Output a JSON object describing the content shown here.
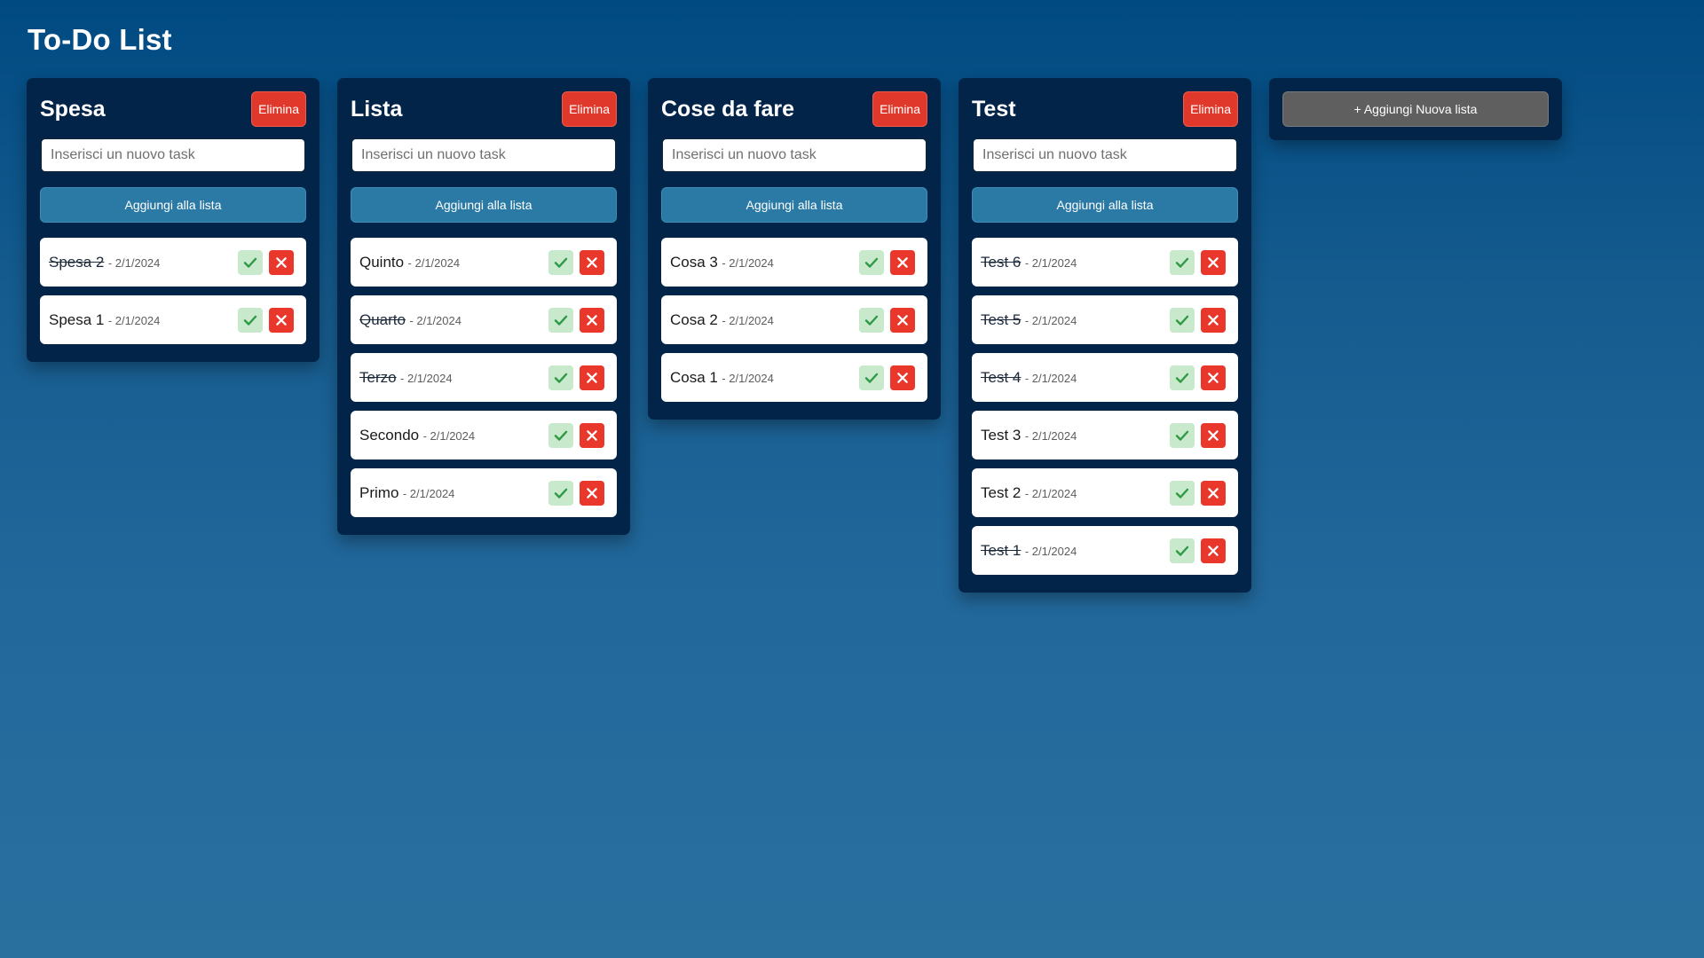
{
  "app": {
    "title": "To-Do List"
  },
  "colors": {
    "background_top": "#004a82",
    "background_bottom": "#2a709f",
    "card": "#022449",
    "delete": "#e0392b",
    "add_task": "#2a7aa5",
    "complete_bg": "#c9e9cc",
    "complete_check": "#2e9a45",
    "remove_bg": "#e9372b",
    "add_list": "#5f5f5f"
  },
  "icons": {
    "complete": "check-icon",
    "remove": "x-close-icon"
  },
  "labels": {
    "delete_list": "Elimina",
    "input_placeholder": "Inserisci un nuovo task",
    "add_task": "Aggiungi alla lista",
    "add_list": "+ Aggiungi Nuova lista"
  },
  "lists": [
    {
      "title": "Spesa",
      "tasks": [
        {
          "name": "Spesa 2",
          "date": "- 2/1/2024",
          "done": true
        },
        {
          "name": "Spesa 1",
          "date": "- 2/1/2024",
          "done": false
        }
      ]
    },
    {
      "title": "Lista",
      "tasks": [
        {
          "name": "Quinto",
          "date": "- 2/1/2024",
          "done": false
        },
        {
          "name": "Quarto",
          "date": "- 2/1/2024",
          "done": true
        },
        {
          "name": "Terzo",
          "date": "- 2/1/2024",
          "done": true
        },
        {
          "name": "Secondo",
          "date": "- 2/1/2024",
          "done": false
        },
        {
          "name": "Primo",
          "date": "- 2/1/2024",
          "done": false
        }
      ]
    },
    {
      "title": "Cose da fare",
      "tasks": [
        {
          "name": "Cosa 3",
          "date": "- 2/1/2024",
          "done": false
        },
        {
          "name": "Cosa 2",
          "date": "- 2/1/2024",
          "done": false
        },
        {
          "name": "Cosa 1",
          "date": "- 2/1/2024",
          "done": false
        }
      ]
    },
    {
      "title": "Test",
      "tasks": [
        {
          "name": "Test 6",
          "date": "- 2/1/2024",
          "done": true
        },
        {
          "name": "Test 5",
          "date": "- 2/1/2024",
          "done": true
        },
        {
          "name": "Test 4",
          "date": "- 2/1/2024",
          "done": true
        },
        {
          "name": "Test 3",
          "date": "- 2/1/2024",
          "done": false
        },
        {
          "name": "Test 2",
          "date": "- 2/1/2024",
          "done": false
        },
        {
          "name": "Test 1",
          "date": "- 2/1/2024",
          "done": true
        }
      ]
    }
  ]
}
